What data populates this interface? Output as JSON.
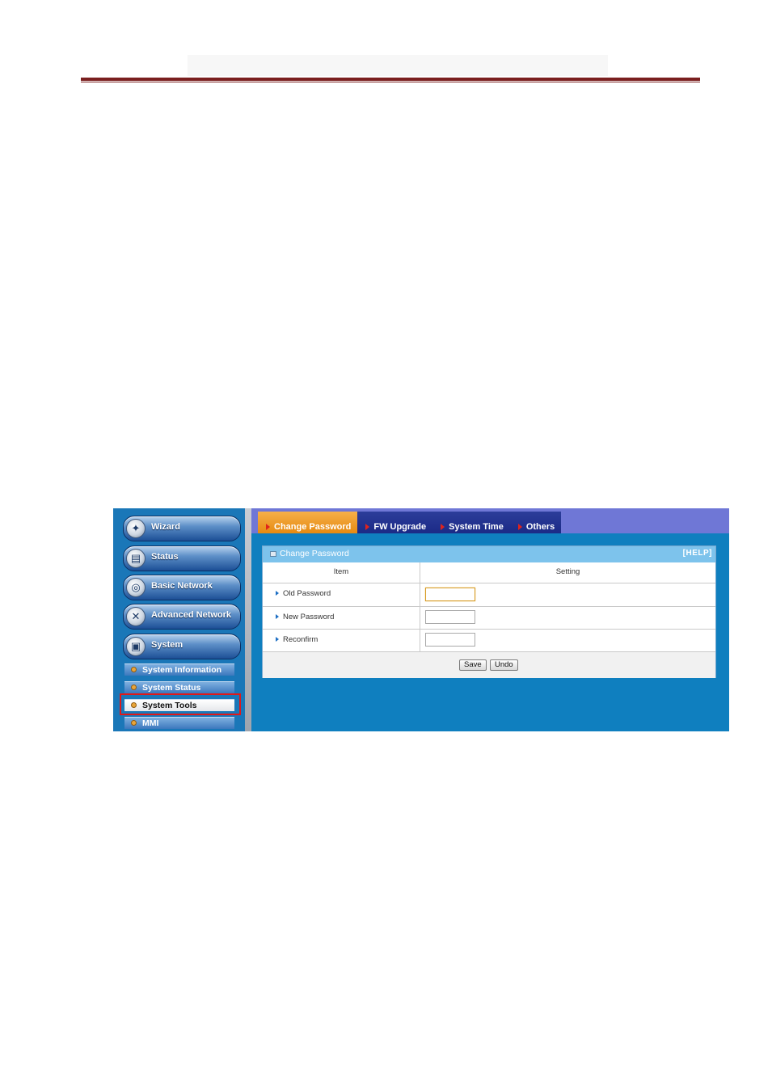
{
  "sidebar": {
    "nav": [
      {
        "label": "Wizard",
        "icon": "wizard-wand-icon"
      },
      {
        "label": "Status",
        "icon": "status-chart-icon"
      },
      {
        "label": "Basic Network",
        "icon": "globe-icon"
      },
      {
        "label": "Advanced Network",
        "icon": "tools-icon"
      },
      {
        "label": "System",
        "icon": "monitor-icon"
      }
    ],
    "sub": [
      {
        "label": "System Information"
      },
      {
        "label": "System Status"
      },
      {
        "label": "System Tools",
        "active": true
      },
      {
        "label": "MMI"
      }
    ]
  },
  "tabs": [
    {
      "label": "Change Password",
      "active": true
    },
    {
      "label": "FW Upgrade"
    },
    {
      "label": "System Time"
    },
    {
      "label": "Others"
    }
  ],
  "panel": {
    "title": "Change Password",
    "help": "[HELP]",
    "col_item": "Item",
    "col_setting": "Setting",
    "rows": [
      {
        "label": "Old Password",
        "value": ""
      },
      {
        "label": "New Password",
        "value": ""
      },
      {
        "label": "Reconfirm",
        "value": ""
      }
    ],
    "save_label": "Save",
    "undo_label": "Undo"
  },
  "colors": {
    "header_rule": "#7a1f1f",
    "highlight": "#e01818",
    "active_tab": "#e68a10",
    "panel_title": "#7dc3ec"
  }
}
